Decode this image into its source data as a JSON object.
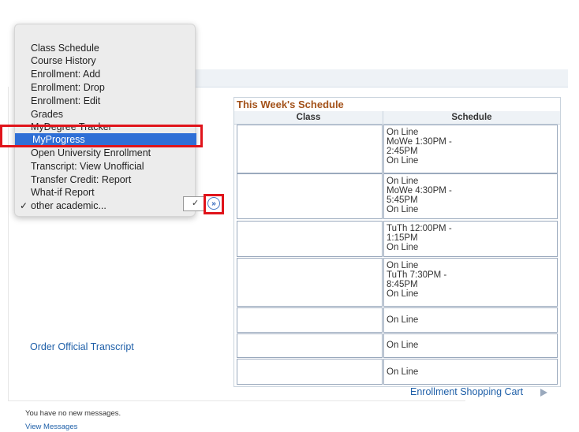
{
  "menu": {
    "items": [
      "Class Schedule",
      "Course History",
      "Enrollment: Add",
      "Enrollment: Drop",
      "Enrollment: Edit",
      "Grades",
      "MyDegree Tracker",
      "MyProgress",
      "Open University Enrollment",
      "Transcript: View Unofficial",
      "Transfer Credit: Report",
      "What-if Report",
      "other academic..."
    ],
    "selected": "MyProgress",
    "checked": "other academic...",
    "check_glyph": "✓"
  },
  "go_button": {
    "icon": "double-chevron-right-icon",
    "glyph": "»"
  },
  "schedule": {
    "title": "This Week's Schedule",
    "headers": {
      "class": "Class",
      "schedule": "Schedule"
    },
    "rows": [
      "On Line\nMoWe 1:30PM -\n2:45PM\nOn Line",
      "On Line\nMoWe 4:30PM -\n5:45PM\nOn Line",
      "TuTh 12:00PM -\n1:15PM\nOn Line",
      "On Line\nTuTh 7:30PM -\n8:45PM\nOn Line",
      "On Line",
      "On Line",
      "On Line"
    ]
  },
  "links": {
    "cart": "Enrollment Shopping Cart",
    "order": "Order Official Transcript",
    "view_messages": "View Messages"
  },
  "messages": {
    "text": "You have no new messages."
  },
  "colors": {
    "accent_red": "#e0141b",
    "selected_blue": "#2f6fd6",
    "link_blue": "#1e5fa8",
    "title_orange": "#a3521a"
  }
}
